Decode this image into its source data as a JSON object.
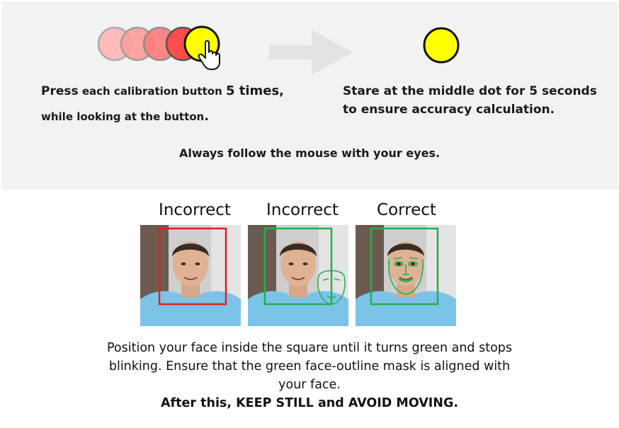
{
  "instructions": {
    "left": {
      "p1": "Press",
      "p2": " each calibration button ",
      "p3": "5 times",
      "p4": ",",
      "line2a": "while looking at the button",
      "line2b": "."
    },
    "right": {
      "line1": "Stare at the middle dot for 5 seconds",
      "line2": "to ensure accuracy calculation."
    },
    "note": "Always follow the mouse with your eyes."
  },
  "examples": [
    {
      "caption": "Incorrect",
      "box_color": "#e02020"
    },
    {
      "caption": "Incorrect",
      "box_color": "#22b14c"
    },
    {
      "caption": "Correct",
      "box_color": "#22b14c"
    }
  ],
  "bottom": {
    "line1": "Position your face inside the square until it turns green and stops",
    "line2": "blinking. Ensure that the green face-outline mask is aligned with",
    "line3": "your face.",
    "bold": "After this, KEEP STILL and AVOID MOVING."
  },
  "colors": {
    "panel_bg": "#f2f2f2",
    "dot_yellow": "#ffff00",
    "dot_red": "#ff4d4d",
    "correct_green": "#22b14c",
    "incorrect_red": "#e02020"
  }
}
